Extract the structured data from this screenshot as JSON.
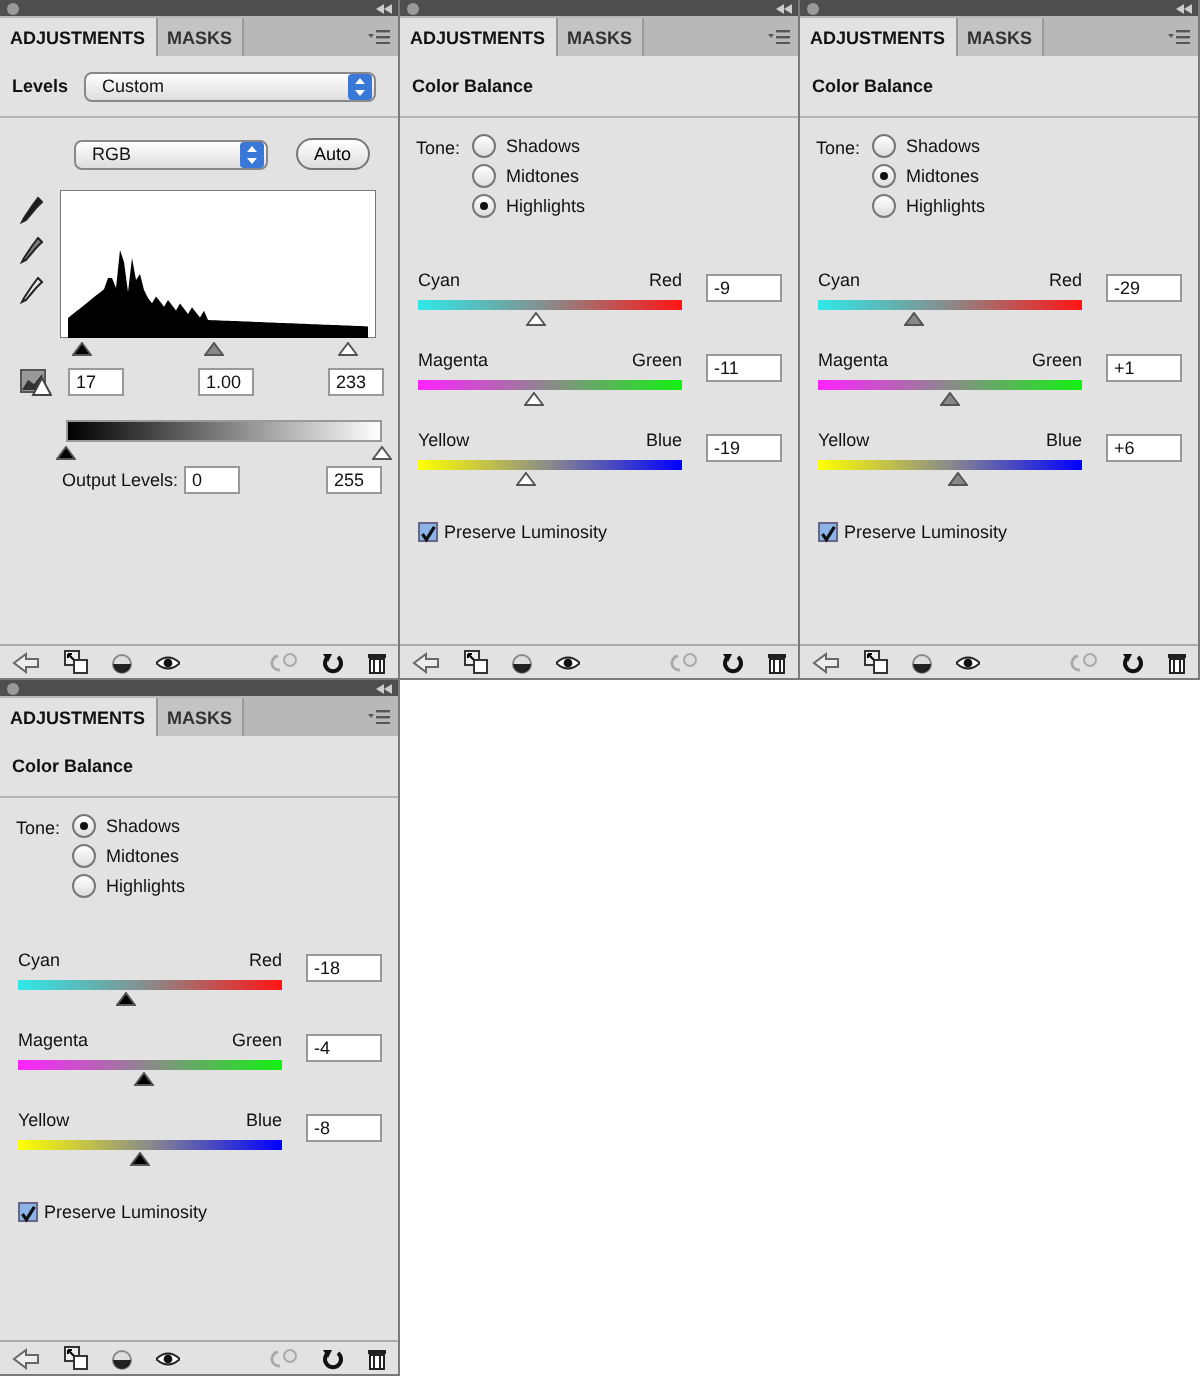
{
  "panels": [
    {
      "kind": "levels",
      "tabs": [
        {
          "label": "ADJUSTMENTS",
          "selected": true
        },
        {
          "label": "MASKS",
          "selected": false
        }
      ],
      "title": "Levels",
      "preset": "Custom",
      "channel": "RGB",
      "auto_button": "Auto",
      "input_levels": [
        {
          "value": "17"
        },
        {
          "value": "1.00"
        },
        {
          "value": "233"
        }
      ],
      "output_label": "Output Levels:",
      "output_levels": [
        {
          "value": "0"
        },
        {
          "value": "255"
        }
      ]
    },
    {
      "kind": "color_balance",
      "tabs": [
        {
          "label": "ADJUSTMENTS",
          "selected": true
        },
        {
          "label": "MASKS",
          "selected": false
        }
      ],
      "title": "Color Balance",
      "tone_label": "Tone:",
      "tones": [
        {
          "label": "Shadows",
          "selected": false
        },
        {
          "label": "Midtones",
          "selected": false
        },
        {
          "label": "Highlights",
          "selected": true
        }
      ],
      "sliders": [
        {
          "left": "Cyan",
          "right": "Red",
          "value": "-9",
          "level": 0.45
        },
        {
          "left": "Magenta",
          "right": "Green",
          "value": "-11",
          "level": 0.44
        },
        {
          "left": "Yellow",
          "right": "Blue",
          "value": "-19",
          "level": 0.41
        }
      ],
      "preserve": {
        "label": "Preserve Luminosity",
        "checked": true
      }
    },
    {
      "kind": "color_balance",
      "tabs": [
        {
          "label": "ADJUSTMENTS",
          "selected": true
        },
        {
          "label": "MASKS",
          "selected": false
        }
      ],
      "title": "Color Balance",
      "tone_label": "Tone:",
      "tones": [
        {
          "label": "Shadows",
          "selected": false
        },
        {
          "label": "Midtones",
          "selected": true
        },
        {
          "label": "Highlights",
          "selected": false
        }
      ],
      "sliders": [
        {
          "left": "Cyan",
          "right": "Red",
          "value": "-29",
          "level": 0.36
        },
        {
          "left": "Magenta",
          "right": "Green",
          "value": "+1",
          "level": 0.5
        },
        {
          "left": "Yellow",
          "right": "Blue",
          "value": "+6",
          "level": 0.53
        }
      ],
      "preserve": {
        "label": "Preserve Luminosity",
        "checked": true
      }
    },
    {
      "kind": "color_balance",
      "tabs": [
        {
          "label": "ADJUSTMENTS",
          "selected": true
        },
        {
          "label": "MASKS",
          "selected": false
        }
      ],
      "title": "Color Balance",
      "tone_label": "Tone:",
      "tones": [
        {
          "label": "Shadows",
          "selected": true
        },
        {
          "label": "Midtones",
          "selected": false
        },
        {
          "label": "Highlights",
          "selected": false
        }
      ],
      "sliders": [
        {
          "left": "Cyan",
          "right": "Red",
          "value": "-18",
          "level": 0.41
        },
        {
          "left": "Magenta",
          "right": "Green",
          "value": "-4",
          "level": 0.48
        },
        {
          "left": "Yellow",
          "right": "Blue",
          "value": "-8",
          "level": 0.46
        }
      ],
      "preserve": {
        "label": "Preserve Luminosity",
        "checked": true
      }
    }
  ]
}
